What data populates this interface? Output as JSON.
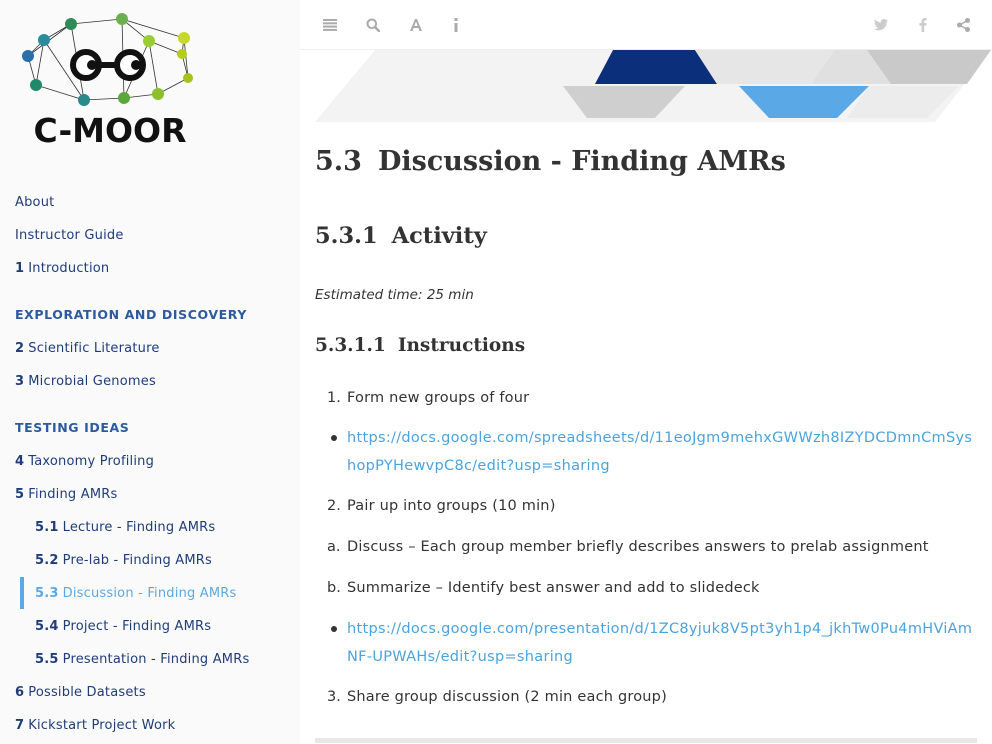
{
  "logo": {
    "text": "C-MOOR"
  },
  "sidebar": {
    "items": [
      {
        "num": "",
        "label": "About"
      },
      {
        "num": "",
        "label": "Instructor Guide"
      },
      {
        "num": "1",
        "label": "Introduction"
      },
      {
        "header": "EXPLORATION AND DISCOVERY"
      },
      {
        "num": "2",
        "label": "Scientific Literature"
      },
      {
        "num": "3",
        "label": "Microbial Genomes"
      },
      {
        "header": "TESTING IDEAS"
      },
      {
        "num": "4",
        "label": "Taxonomy Profiling"
      },
      {
        "num": "5",
        "label": "Finding AMRs"
      },
      {
        "num": "5.1",
        "label": "Lecture - Finding AMRs"
      },
      {
        "num": "5.2",
        "label": "Pre-lab - Finding AMRs"
      },
      {
        "num": "5.3",
        "label": "Discussion - Finding AMRs"
      },
      {
        "num": "5.4",
        "label": "Project - Finding AMRs"
      },
      {
        "num": "5.5",
        "label": "Presentation - Finding AMRs"
      },
      {
        "num": "6",
        "label": "Possible Datasets"
      },
      {
        "num": "7",
        "label": "Kickstart Project Work"
      }
    ]
  },
  "toolbar": {
    "left": [
      "menu-icon",
      "search-icon",
      "font-settings-icon",
      "info-icon"
    ],
    "right": [
      "twitter-icon",
      "facebook-icon",
      "share-icon"
    ]
  },
  "content": {
    "h1": {
      "num": "5.3",
      "title": "Discussion - Finding AMRs"
    },
    "h2": {
      "num": "5.3.1",
      "title": "Activity"
    },
    "estimated": "Estimated time: 25 min",
    "h3": {
      "num": "5.3.1.1",
      "title": "Instructions"
    },
    "list": {
      "item1": {
        "marker": "1.",
        "text": "Form new groups of four"
      },
      "link1": "https://docs.google.com/spreadsheets/d/11eoJgm9mehxGWWzh8IZYDCDmnCmSyshopPYHewvpC8c/edit?usp=sharing",
      "item2": {
        "marker": "2.",
        "text": "Pair up into groups (10 min)"
      },
      "itemA": {
        "marker": "a.",
        "text": "Discuss – Each group member briefly describes answers to prelab assignment"
      },
      "itemB": {
        "marker": "b.",
        "text": "Summarize – Identify best answer and add to slidedeck"
      },
      "link2": "https://docs.google.com/presentation/d/1ZC8yjuk8V5pt3yh1p4_jkhTw0Pu4mHViAmNF-UPWAHs/edit?usp=sharing",
      "item3": {
        "marker": "3.",
        "text": "Share group discussion (2 min each group)"
      }
    }
  },
  "colors": {
    "accent": "#5aa9e6",
    "nav_text": "#1f3d7a",
    "link": "#4aa3df",
    "banner_navy": "#0b2f7a",
    "banner_blue": "#5aa9e6",
    "banner_gray": "#c9c9c9"
  }
}
